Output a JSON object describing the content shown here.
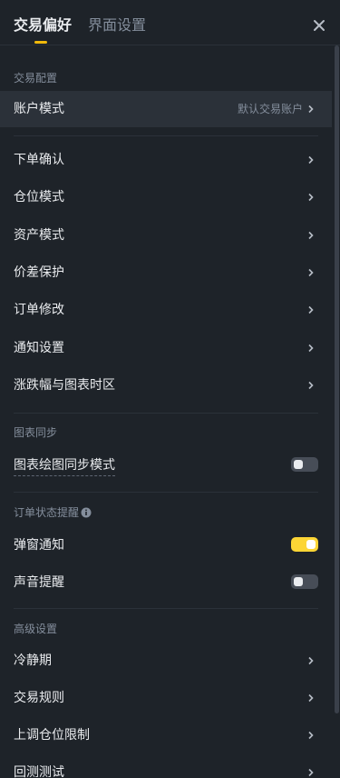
{
  "header": {
    "tabs": [
      {
        "label": "交易偏好",
        "active": true
      },
      {
        "label": "界面设置",
        "active": false
      }
    ],
    "close_icon": "close-icon"
  },
  "accent_color": "#f0b90b",
  "sections": {
    "trade_config": {
      "title": "交易配置",
      "account_mode": {
        "label": "账户模式",
        "value": "默认交易账户"
      },
      "items": [
        {
          "label": "下单确认"
        },
        {
          "label": "仓位模式"
        },
        {
          "label": "资产模式"
        },
        {
          "label": "价差保护"
        },
        {
          "label": "订单修改"
        },
        {
          "label": "通知设置"
        },
        {
          "label": "涨跌幅与图表时区"
        }
      ]
    },
    "chart_sync": {
      "title": "图表同步",
      "drawing_sync": {
        "label": "图表绘图同步模式",
        "enabled": false
      }
    },
    "order_status": {
      "title": "订单状态提醒",
      "info_icon": "info-icon",
      "popup": {
        "label": "弹窗通知",
        "enabled": true
      },
      "sound": {
        "label": "声音提醒",
        "enabled": false
      }
    },
    "advanced": {
      "title": "高级设置",
      "items": [
        {
          "label": "冷静期"
        },
        {
          "label": "交易规则"
        },
        {
          "label": "上调仓位限制"
        },
        {
          "label": "回测测试"
        }
      ]
    }
  }
}
